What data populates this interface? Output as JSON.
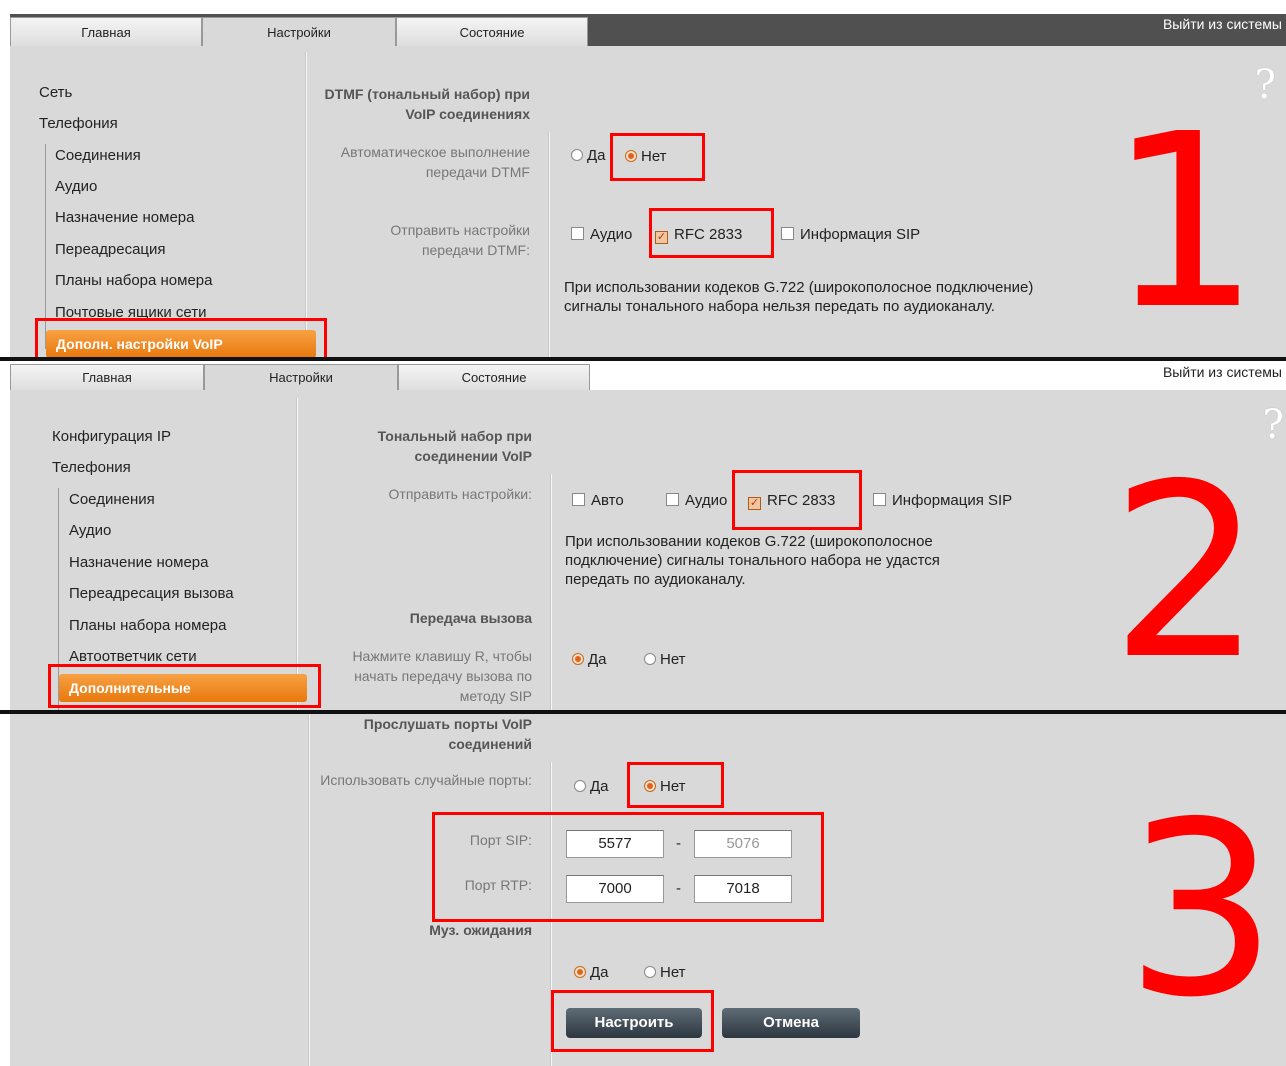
{
  "panel1": {
    "tabs": [
      "Главная",
      "Настройки",
      "Состояние"
    ],
    "logout": "Выйти из системы",
    "help": "?",
    "nav": [
      "Сеть",
      "Телефония",
      "Соединения",
      "Аудио",
      "Назначение номера",
      "Переадресация",
      "Планы набора номера",
      "Почтовые ящики сети",
      "Дополн. настройки VoIP"
    ],
    "section_title": "DTMF (тональный набор) при VoIP соединениях",
    "auto_label": "Автоматическое выполнение передачи DTMF",
    "yes": "Да",
    "no": "Нет",
    "send_label": "Отправить настройки передачи DTMF:",
    "audio": "Аудио",
    "rfc": "RFC 2833",
    "sip_info": "Информация SIP",
    "note": "При использовании кодеков G.722 (широкополосное подключение) сигналы тонального набора нельзя передать по аудиоканалу.",
    "number": "1"
  },
  "panel2": {
    "tabs": [
      "Главная",
      "Настройки",
      "Состояние"
    ],
    "logout": "Выйти из системы",
    "help": "?",
    "nav": [
      "Конфигурация IP",
      "Телефония",
      "Соединения",
      "Аудио",
      "Назначение номера",
      "Переадресация вызова",
      "Планы набора номера",
      "Автоответчик сети",
      "Дополнительные"
    ],
    "section_title": "Тональный набор при соединении VoIP",
    "send_label": "Отправить настройки:",
    "auto": "Авто",
    "audio": "Аудио",
    "rfc": "RFC 2833",
    "sip_info": "Информация SIP",
    "note": "При использовании кодеков G.722 (широкополосное подключение) сигналы тонального набора не удастся передать по аудиоканалу.",
    "transfer_title": "Передача вызова",
    "transfer_label": "Нажмите клавишу R, чтобы начать передачу вызова по методу SIP",
    "yes": "Да",
    "no": "Нет",
    "number": "2"
  },
  "panel3": {
    "ports_title": "Прослушать порты VoIP соединений",
    "random_label": "Использовать случайные порты:",
    "yes": "Да",
    "no": "Нет",
    "sip_port_label": "Порт SIP:",
    "sip_from": "5577",
    "sip_to": "5076",
    "rtp_port_label": "Порт RTP:",
    "rtp_from": "7000",
    "rtp_to": "7018",
    "dash": "-",
    "music_title": "Муз. ожидания",
    "apply": "Настроить",
    "cancel": "Отмена",
    "number": "3"
  },
  "colors": {
    "highlight": "#ff0000",
    "active_nav": "#e8780c",
    "panel_bg": "#d9d9d9"
  }
}
